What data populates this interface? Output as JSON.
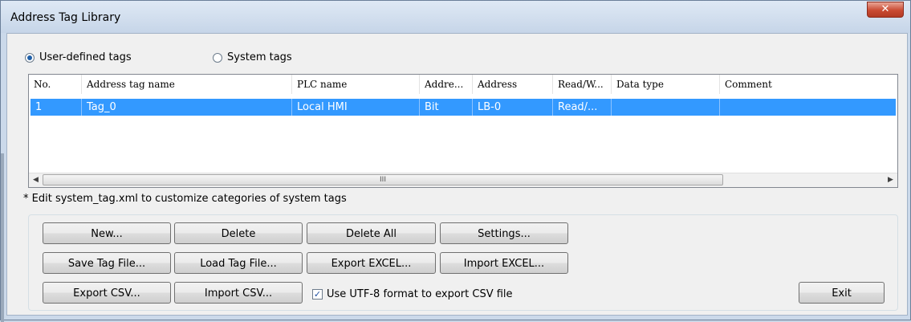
{
  "window": {
    "title": "Address Tag Library",
    "close_glyph": "✕"
  },
  "radios": [
    {
      "label": "User-defined tags",
      "selected": true
    },
    {
      "label": "System tags",
      "selected": false
    }
  ],
  "table": {
    "columns": [
      "No.",
      "Address tag name",
      "PLC name",
      "Addre...",
      "Address",
      "Read/W...",
      "Data type",
      "Comment"
    ],
    "rows": [
      [
        "1",
        "Tag_0",
        "Local HMI",
        "Bit",
        "LB-0",
        "Read/...",
        "",
        ""
      ]
    ],
    "scroll_thumb_glyph": "III"
  },
  "note": "* Edit system_tag.xml to customize categories of system tags",
  "buttons": {
    "new": "New...",
    "delete": "Delete",
    "delete_all": "Delete All",
    "settings": "Settings...",
    "save_tag_file": "Save Tag File...",
    "load_tag_file": "Load Tag File...",
    "export_excel": "Export EXCEL...",
    "import_excel": "Import EXCEL...",
    "export_csv": "Export CSV...",
    "import_csv": "Import CSV...",
    "exit": "Exit"
  },
  "utf8_checkbox": {
    "label": "Use UTF-8 format to export CSV file",
    "checked": true
  },
  "colors": {
    "selection": "#3399ff",
    "title_bar": "#c6d5e8",
    "close_button": "#c94a32"
  }
}
